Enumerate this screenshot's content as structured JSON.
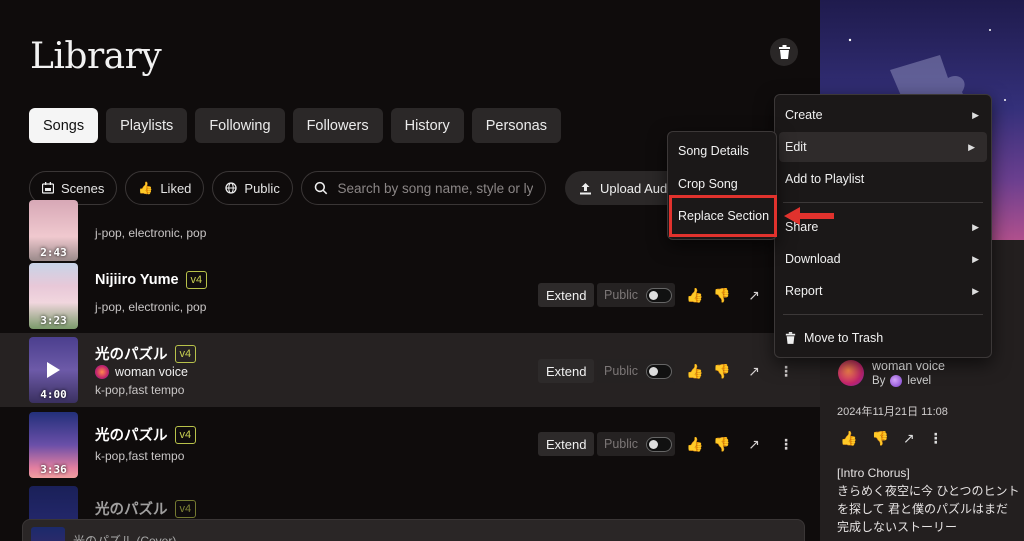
{
  "page": {
    "title": "Library"
  },
  "tabs": [
    {
      "label": "Songs",
      "active": true
    },
    {
      "label": "Playlists"
    },
    {
      "label": "Following"
    },
    {
      "label": "Followers"
    },
    {
      "label": "History"
    },
    {
      "label": "Personas"
    }
  ],
  "filters": {
    "scenes": "Scenes",
    "liked": "Liked",
    "public": "Public",
    "search_placeholder": "Search by song name, style or lyrics",
    "upload": "Upload Audio"
  },
  "songs": [
    {
      "title": "",
      "version": "",
      "style": "j-pop, electronic, pop",
      "duration": "2:43"
    },
    {
      "title": "Nijiiro Yume",
      "version": "v4",
      "style": "j-pop, electronic, pop",
      "duration": "3:23"
    },
    {
      "title": "光のパズル",
      "version": "v4",
      "artist": "woman voice",
      "style": "k-pop,fast tempo",
      "duration": "4:00",
      "highlighted": true
    },
    {
      "title": "光のパズル",
      "version": "v4",
      "style": "k-pop,fast tempo",
      "duration": "3:36"
    },
    {
      "title": "光のパズル",
      "version": "v4",
      "style": "",
      "duration": ""
    }
  ],
  "row_actions": {
    "extend": "Extend",
    "public": "Public"
  },
  "context_menu": {
    "items": [
      "Create",
      "Edit",
      "Add to Playlist",
      "Share",
      "Download",
      "Report",
      "Move to Trash"
    ]
  },
  "submenu": {
    "items": [
      "Song Details",
      "Crop Song",
      "Replace Section"
    ]
  },
  "right_panel": {
    "artist": "woman voice",
    "by_label": "By",
    "by_user": "level",
    "date": "2024年11月21日 11:08",
    "lyrics_lines": [
      "[Intro Chorus]",
      "きらめく夜空に今 ひとつのヒントを探して 君と僕のパズルはまだ",
      "完成しないストーリー"
    ]
  },
  "player": {
    "title": "光のパズル (Cover)"
  },
  "colors": {
    "highlight": "#e1322d",
    "badge": "#c9d152"
  }
}
